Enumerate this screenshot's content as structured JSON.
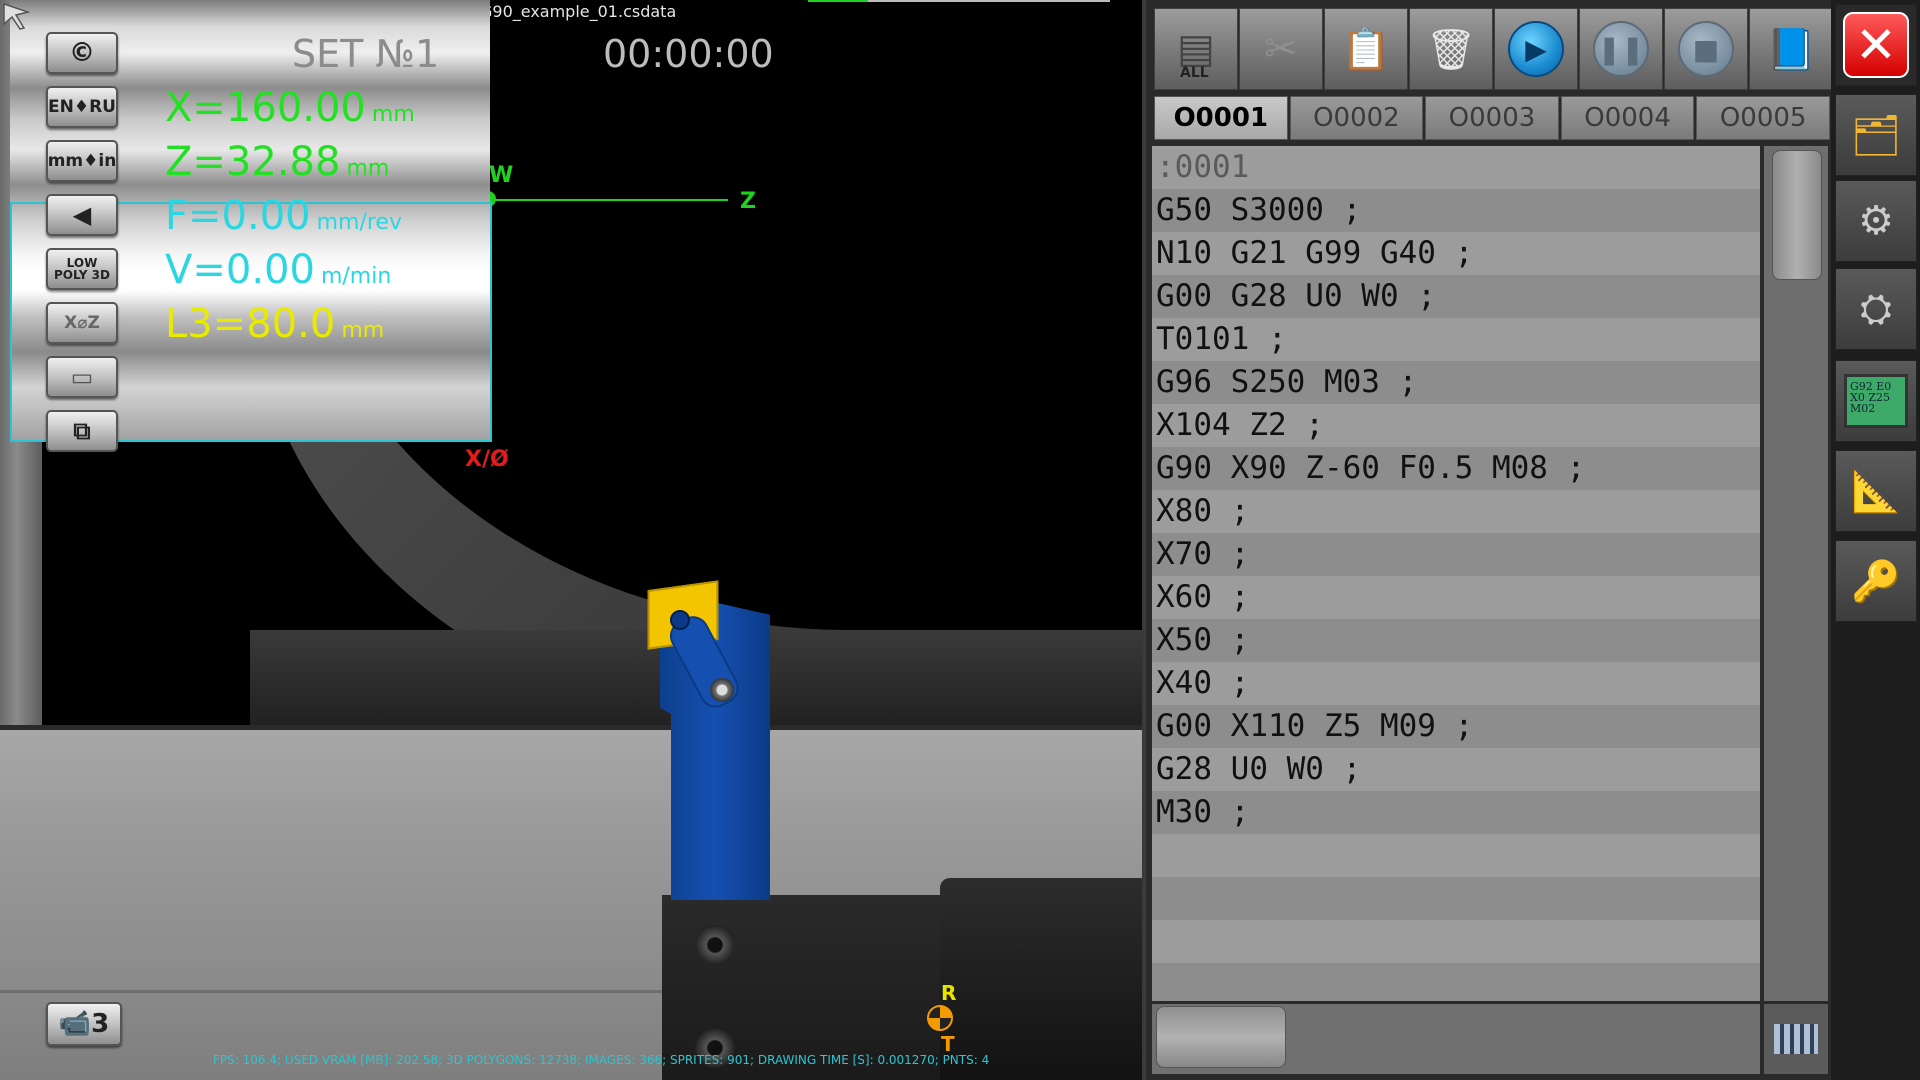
{
  "window": {
    "file_title": "G90_example_01.csdata",
    "timer": "00:00:00",
    "fps_line": "FPS: 106.4; USED VRAM [MB]: 202.58; 3D POLYGONS: 12738; IMAGES: 366; SPRITES: 901; DRAWING TIME [S]: 0.001270; PNTS: 4"
  },
  "overlay": {
    "set_label": "SET №1",
    "readouts": [
      {
        "value": "X=160.00",
        "unit": "mm",
        "color": "#22e022"
      },
      {
        "value": "Z=32.88",
        "unit": "mm",
        "color": "#22e022"
      },
      {
        "value": "F=0.00",
        "unit": "mm/rev",
        "color": "#29d6e2"
      },
      {
        "value": "V=0.00",
        "unit": "m/min",
        "color": "#29d6e2"
      },
      {
        "value": "L3=80.0",
        "unit": "mm",
        "color": "#e8ea00"
      }
    ],
    "buttons": [
      {
        "label": "©",
        "icon": "copyright-icon"
      },
      {
        "label": "EN♦RU",
        "icon": "language-icon"
      },
      {
        "label": "mm♦in",
        "icon": "units-icon"
      },
      {
        "label": "◀",
        "icon": "mute-icon"
      },
      {
        "label": "LOW POLY 3D",
        "icon": "lowpoly-icon"
      },
      {
        "label": "X⌀Z",
        "icon": "diameter-icon"
      },
      {
        "label": "▭",
        "icon": "toolpath-icon"
      },
      {
        "label": "⧉",
        "icon": "fit-view-icon"
      }
    ],
    "camera_label": "📹3"
  },
  "axes": {
    "w_label": "W",
    "z_label": "Z",
    "x_label": "X/Ø",
    "r_label": "R",
    "t_label": "T"
  },
  "editor": {
    "toolbar": [
      {
        "icon": "select-all-icon",
        "label": "ALL"
      },
      {
        "icon": "cut-icon",
        "label": ""
      },
      {
        "icon": "paste-icon",
        "label": ""
      },
      {
        "icon": "trash-icon",
        "label": ""
      },
      {
        "icon": "play-icon",
        "label": ""
      },
      {
        "icon": "pause-icon",
        "label": ""
      },
      {
        "icon": "stop-icon",
        "label": ""
      },
      {
        "icon": "book-icon",
        "label": ""
      }
    ],
    "tabs": [
      "O0001",
      "O0002",
      "O0003",
      "O0004",
      "O0005"
    ],
    "active_tab": "O0001",
    "code_header": ":0001",
    "code_lines": [
      "G50 S3000 ;",
      "N10 G21 G99 G40 ;",
      "G00 G28 U0 W0 ;",
      "T0101 ;",
      "G96 S250 M03 ;",
      "X104 Z2 ;",
      "G90 X90 Z-60 F0.5 M08 ;",
      "X80 ;",
      "X70 ;",
      "X60 ;",
      "X50 ;",
      "X40 ;",
      "G00 X110 Z5 M09 ;",
      "G28 U0 W0 ;",
      "M30 ;"
    ]
  },
  "right_column": {
    "buttons": [
      {
        "icon": "close-icon"
      },
      {
        "icon": "folder-save-icon"
      },
      {
        "icon": "chuck-icon"
      },
      {
        "icon": "tool-icon"
      },
      {
        "icon": "gcode-editor-icon",
        "text": "G92 E0 X0 Z25 M02"
      },
      {
        "icon": "caliper-icon"
      },
      {
        "icon": "key-icon"
      }
    ]
  }
}
